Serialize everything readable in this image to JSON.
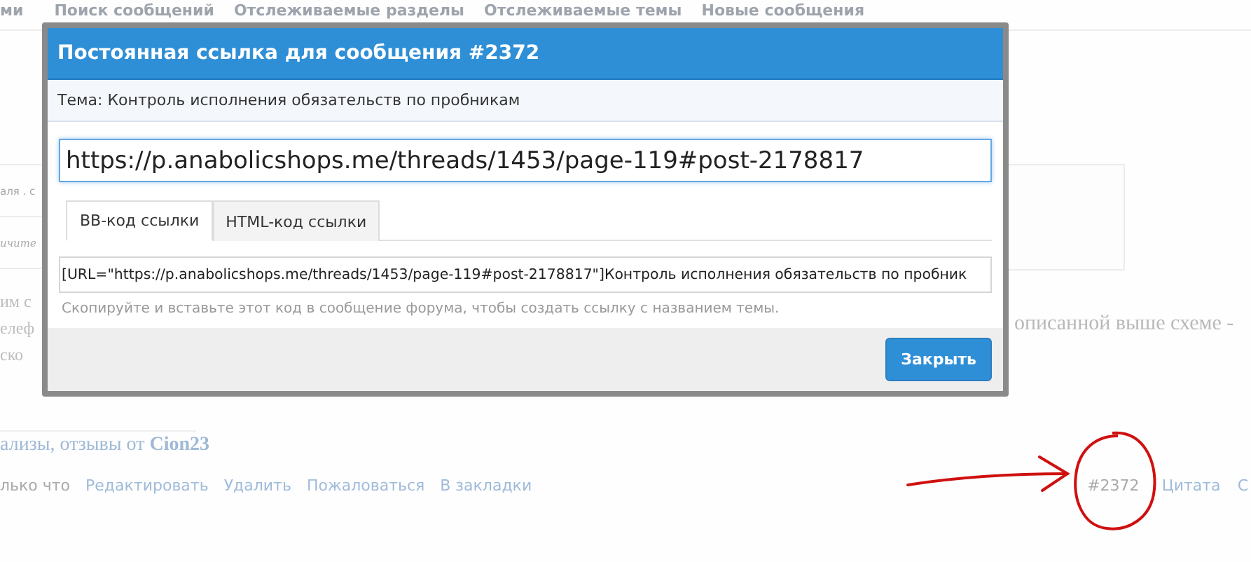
{
  "nav": {
    "items": [
      "ми",
      "Поиск сообщений",
      "Отслеживаемые разделы",
      "Отслеживаемые темы",
      "Новые сообщения"
    ]
  },
  "background": {
    "left_snippets": [
      "аля . с",
      "ичите"
    ],
    "left_lines": [
      "им с",
      "елеф",
      "ско"
    ],
    "right_text": "описанной выше схеме -",
    "thread_link": {
      "text": "ализы, отзывы от",
      "author": "Cion23"
    },
    "actions": [
      {
        "text": "лько что",
        "kind": "date"
      },
      {
        "text": "Редактировать",
        "kind": "link"
      },
      {
        "text": "Удалить",
        "kind": "link"
      },
      {
        "text": "Пожаловаться",
        "kind": "link"
      },
      {
        "text": "В закладки",
        "kind": "link"
      }
    ],
    "post_number": "#2372",
    "right_actions": [
      "Цитата",
      "С"
    ]
  },
  "dialog": {
    "title": "Постоянная ссылка для сообщения #2372",
    "topic": "Тема: Контроль исполнения обязательств по пробникам",
    "url": "https://p.anabolicshops.me/threads/1453/page-119#post-2178817",
    "tabs": [
      {
        "label": "BB-код ссылки",
        "selected": true
      },
      {
        "label": "HTML-код ссылки",
        "selected": false
      }
    ],
    "code": "[URL=\"https://p.anabolicshops.me/threads/1453/page-119#post-2178817\"]Контроль исполнения обязательств по пробник",
    "hint": "Скопируйте и вставьте этот код в сообщение форума, чтобы создать ссылку с названием темы.",
    "button": "Закрыть"
  }
}
